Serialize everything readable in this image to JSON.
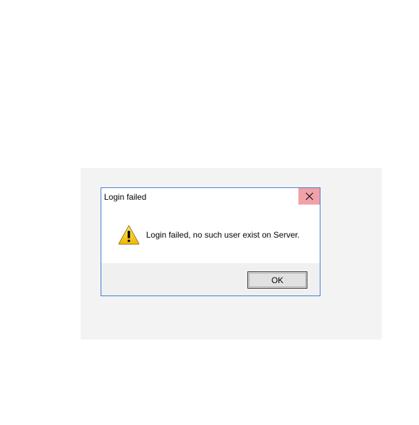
{
  "dialog": {
    "title": "Login failed",
    "message": "Login failed, no such user exist on Server.",
    "ok_label": "OK",
    "icon": "warning-icon",
    "close_icon": "close-icon"
  },
  "colors": {
    "window_border": "#3c7fd0",
    "close_hover_bg": "#f1a1a8",
    "footer_bg": "#f0f0f0",
    "backdrop_bg": "#f3f3f3",
    "warning_yellow": "#f5c211"
  }
}
